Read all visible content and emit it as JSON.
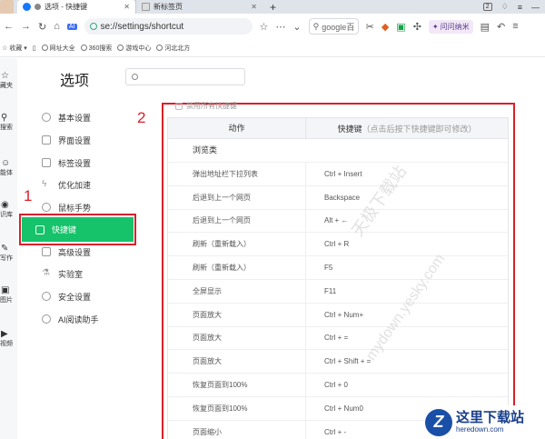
{
  "tabs": [
    {
      "label": "选项 - 快捷键",
      "active": true
    },
    {
      "label": "新标签页",
      "active": false
    }
  ],
  "new_tab_label": "+",
  "tabbar_badge": "2",
  "address": {
    "url": "se://settings/shortcut",
    "search_placeholder": "google百"
  },
  "toolbar": {
    "ai_label": "问问纳米"
  },
  "bookmarks": [
    {
      "label": "收藏",
      "icon": "star-icon"
    },
    {
      "label": "网址大全",
      "icon": "globe-icon"
    },
    {
      "label": "360搜索",
      "icon": "globe-icon"
    },
    {
      "label": "游戏中心",
      "icon": "globe-icon"
    },
    {
      "label": "河北北方",
      "icon": "globe-icon"
    }
  ],
  "rail": [
    {
      "label": "藏夹",
      "icon": "star-icon"
    },
    {
      "label": "搜索",
      "icon": "search-icon"
    },
    {
      "label": "能体",
      "icon": "bot-icon"
    },
    {
      "label": "识库",
      "icon": "book-icon"
    },
    {
      "label": "写作",
      "icon": "pen-icon"
    },
    {
      "label": "图片",
      "icon": "image-icon"
    },
    {
      "label": "视频",
      "icon": "video-icon"
    }
  ],
  "page_title": "选项",
  "nav": [
    {
      "label": "基本设置",
      "icon": "gear-icon"
    },
    {
      "label": "界面设置",
      "icon": "layout-icon"
    },
    {
      "label": "标签设置",
      "icon": "tag-icon"
    },
    {
      "label": "优化加速",
      "icon": "bolt-icon"
    },
    {
      "label": "鼠标手势",
      "icon": "mouse-icon"
    },
    {
      "label": "快捷键",
      "icon": "keyboard-icon",
      "active": true
    },
    {
      "label": "高级设置",
      "icon": "advanced-icon"
    },
    {
      "label": "实验室",
      "icon": "flask-icon"
    },
    {
      "label": "安全设置",
      "icon": "shield-icon"
    },
    {
      "label": "AI阅读助手",
      "icon": "ai-icon"
    }
  ],
  "annotations": {
    "one": "1",
    "two": "2"
  },
  "disable_all_label": "禁用所有快捷键",
  "table": {
    "header_action": "动作",
    "header_key": "快捷键",
    "header_hint": "（点击后按下快捷键即可修改）",
    "section": "浏览类",
    "rows": [
      {
        "action": "弹出地址栏下拉列表",
        "key": "Ctrl + Insert"
      },
      {
        "action": "后退到上一个网页",
        "key": "Backspace"
      },
      {
        "action": "后退到上一个网页",
        "key": "Alt + ←"
      },
      {
        "action": "刷新（重新载入）",
        "key": "Ctrl + R"
      },
      {
        "action": "刷新（重新载入）",
        "key": "F5"
      },
      {
        "action": "全屏显示",
        "key": "F11"
      },
      {
        "action": "页面放大",
        "key": "Ctrl + Num+"
      },
      {
        "action": "页面放大",
        "key": "Ctrl + ="
      },
      {
        "action": "页面放大",
        "key": "Ctrl + Shift + ="
      },
      {
        "action": "恢复页面到100%",
        "key": "Ctrl + 0"
      },
      {
        "action": "恢复页面到100%",
        "key": "Ctrl + Num0"
      },
      {
        "action": "页面缩小",
        "key": "Ctrl + -"
      }
    ]
  },
  "watermark": {
    "line1": "天极下载站",
    "line2": "mydown.yesky.com"
  },
  "logo": {
    "cn": "这里下载站",
    "en": "heredown.com",
    "mark": "Z"
  },
  "colors": {
    "accent_green": "#16c26a",
    "annotation_red": "#d9202a"
  }
}
